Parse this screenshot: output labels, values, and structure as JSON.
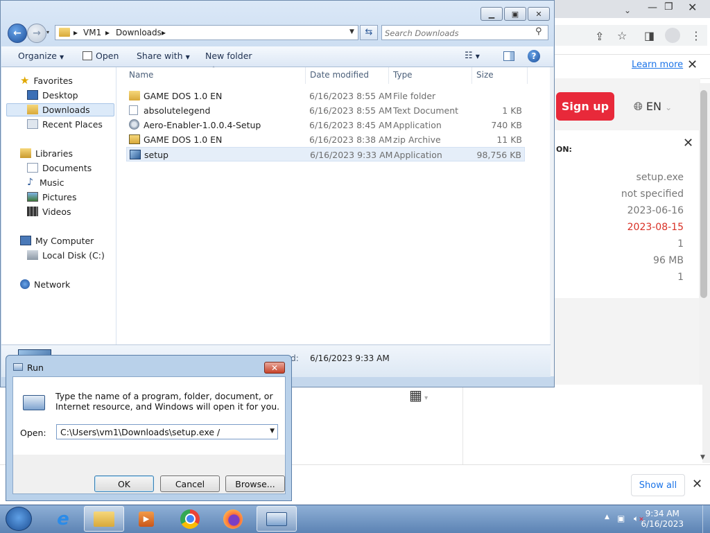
{
  "browser": {
    "info_link": "Learn more",
    "signup_label": "Sign up",
    "lang_label": "EN",
    "card_label": "ON:",
    "card_values": [
      "setup.exe",
      "not specified",
      "2023-06-16",
      "2023-08-15",
      "1",
      "96 MB",
      "1"
    ],
    "show_all": "Show all",
    "accent_red": "#e8293a",
    "link_blue": "#1a73e8"
  },
  "explorer": {
    "breadcrumb": [
      "VM1",
      "Downloads"
    ],
    "search_placeholder": "Search Downloads",
    "commands": {
      "organize": "Organize",
      "open": "Open",
      "share_with": "Share with",
      "new_folder": "New folder"
    },
    "nav": {
      "favorites": "Favorites",
      "desktop": "Desktop",
      "downloads": "Downloads",
      "recent_places": "Recent Places",
      "libraries": "Libraries",
      "documents": "Documents",
      "music": "Music",
      "pictures": "Pictures",
      "videos": "Videos",
      "my_computer": "My Computer",
      "local_disk": "Local Disk (C:)",
      "network": "Network"
    },
    "columns": {
      "name": "Name",
      "date_modified": "Date modified",
      "type": "Type",
      "size": "Size"
    },
    "files": [
      {
        "name": "GAME DOS 1.0 EN",
        "date": "6/16/2023 8:55 AM",
        "type": "File folder",
        "size": "",
        "icon": "folder-icon"
      },
      {
        "name": "absolutelegend",
        "date": "6/16/2023 8:55 AM",
        "type": "Text Document",
        "size": "1 KB",
        "icon": "text-file-icon"
      },
      {
        "name": "Aero-Enabler-1.0.0.4-Setup",
        "date": "6/16/2023 8:45 AM",
        "type": "Application",
        "size": "740 KB",
        "icon": "gear-app-icon"
      },
      {
        "name": "GAME DOS 1.0 EN",
        "date": "6/16/2023 8:38 AM",
        "type": "zip Archive",
        "size": "11 KB",
        "icon": "zip-icon"
      },
      {
        "name": "setup",
        "date": "6/16/2023 9:33 AM",
        "type": "Application",
        "size": "98,756 KB",
        "icon": "setup-app-icon"
      }
    ],
    "details": {
      "date_created_label": "ted:",
      "date_created_value": "6/16/2023 9:33 AM"
    }
  },
  "run_dialog": {
    "title": "Run",
    "description": "Type the name of a program, folder, document, or Internet resource, and Windows will open it for you.",
    "open_label": "Open:",
    "open_value": "C:\\Users\\vm1\\Downloads\\setup.exe /",
    "ok": "OK",
    "cancel": "Cancel",
    "browse": "Browse..."
  },
  "taskbar": {
    "time": "9:34 AM",
    "date": "6/16/2023"
  }
}
